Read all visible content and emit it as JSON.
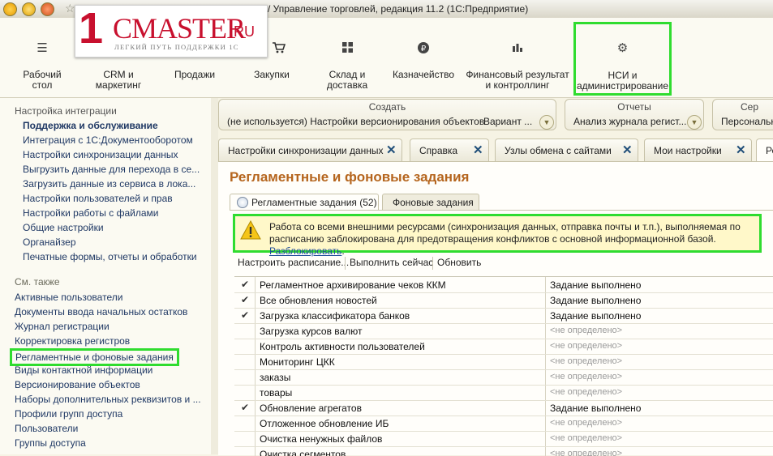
{
  "window": {
    "title": "/ Управление торговлей, редакция 11.2  (1С:Предприятие)"
  },
  "logo": {
    "big": "1",
    "word": "CMASTER",
    "ru": ".RU",
    "tagline": "ЛЕГКИЙ ПУТЬ ПОДДЕРЖКИ 1С"
  },
  "sections": [
    {
      "label": "Рабочий\nстол",
      "icon": "hamburger-icon"
    },
    {
      "label": "CRM и\nмаркетинг",
      "icon": "crm-icon"
    },
    {
      "label": "Продажи",
      "icon": "sales-icon"
    },
    {
      "label": "Закупки",
      "icon": "cart-icon"
    },
    {
      "label": "Склад и\nдоставка",
      "icon": "grid-icon"
    },
    {
      "label": "Казначейство",
      "icon": "ruble-icon"
    },
    {
      "label": "Финансовый результат\nи контроллинг",
      "icon": "bar-chart-icon"
    },
    {
      "label": "НСИ и\nадминистрирование",
      "icon": "gear-icon"
    }
  ],
  "leftnav": {
    "group_title": "Настройка интеграции",
    "items": [
      "Поддержка и обслуживание",
      "Интеграция с 1С:Документооборотом",
      "Настройки синхронизации данных",
      "Выгрузить данные для перехода в се...",
      "Загрузить данные из сервиса в лока...",
      "Настройки пользователей и прав",
      "Настройки работы с файлами",
      "Общие настройки",
      "Органайзер",
      "Печатные формы, отчеты и обработки"
    ],
    "see_also_title": "См. также",
    "see_also": [
      "Активные пользователи",
      "Документы ввода начальных остатков",
      "Журнал регистрации",
      "Корректировка регистров",
      "Регламентные и фоновые задания",
      "Виды контактной информации",
      "Версионирование объектов",
      "Наборы дополнительных реквизитов и ...",
      "Профили групп доступа",
      "Пользователи",
      "Группы доступа"
    ]
  },
  "groups": [
    {
      "title": "Создать",
      "sub": "(не используется) Настройки версионирования объектов",
      "sub2": "Вариант ..."
    },
    {
      "title": "Отчеты",
      "sub": "Анализ журнала регист..."
    },
    {
      "title": "Сер",
      "sub": "Персональн"
    }
  ],
  "tabs": [
    {
      "label": "Настройки синхронизации данных"
    },
    {
      "label": "Справка"
    },
    {
      "label": "Узлы обмена с сайтами"
    },
    {
      "label": "Мои настройки"
    },
    {
      "label": "Ре"
    }
  ],
  "page": {
    "title": "Регламентные и фоновые задания",
    "inner_tabs": [
      "Регламентные задания (52)",
      "Фоновые задания"
    ],
    "warning": "Работа со всеми внешними ресурсами (синхронизация данных, отправка почты и т.п.), выполняемая по расписанию заблокирована для предотвращения конфликтов с основной информационной базой.",
    "warning_link": "Разблокировать",
    "commands": [
      "Настроить расписание...",
      "Выполнить сейчас",
      "Обновить"
    ]
  },
  "jobs": [
    {
      "checked": true,
      "name": "Регламентное архивирование чеков ККМ",
      "status": "Задание выполнено"
    },
    {
      "checked": true,
      "name": "Все обновления новостей",
      "status": "Задание выполнено"
    },
    {
      "checked": true,
      "name": "Загрузка классификатора банков",
      "status": "Задание выполнено"
    },
    {
      "checked": false,
      "name": "Загрузка курсов валют",
      "status": "<не определено>"
    },
    {
      "checked": false,
      "name": "Контроль активности пользователей",
      "status": "<не определено>"
    },
    {
      "checked": false,
      "name": "Мониторинг ЦКК",
      "status": "<не определено>"
    },
    {
      "checked": false,
      "name": "заказы",
      "status": "<не определено>"
    },
    {
      "checked": false,
      "name": "товары",
      "status": "<не определено>"
    },
    {
      "checked": true,
      "name": "Обновление агрегатов",
      "status": "Задание выполнено"
    },
    {
      "checked": false,
      "name": "Отложенное обновление ИБ",
      "status": "<не определено>"
    },
    {
      "checked": false,
      "name": "Очистка ненужных файлов",
      "status": "<не определено>"
    },
    {
      "checked": false,
      "name": "Очистка сегментов",
      "status": "<не определено>"
    }
  ],
  "colors": {
    "highlight": "#2fdc2f",
    "accent_title": "#b5651d",
    "link": "#1f3864"
  }
}
